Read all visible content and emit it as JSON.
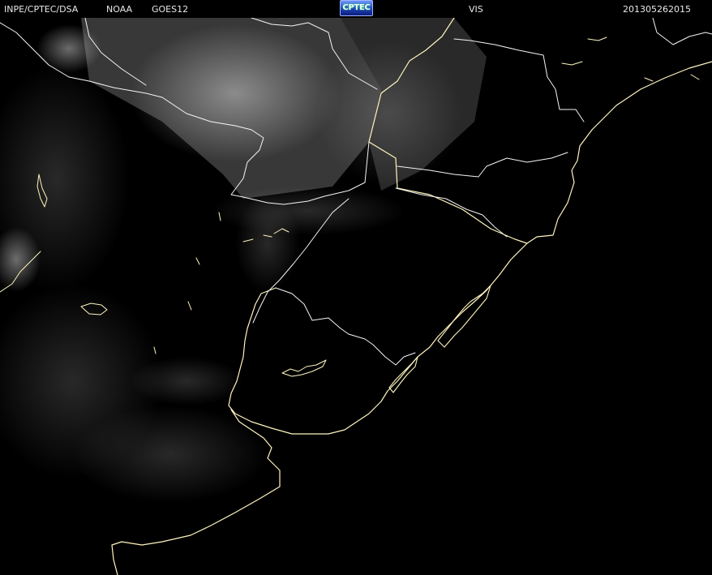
{
  "header": {
    "agency": "INPE/CPTEC/DSA",
    "source": "NOAA",
    "satellite": "GOES12",
    "logo_text": "CPTEC",
    "channel": "VIS",
    "timestamp": "201305262015"
  },
  "colors": {
    "background": "#000000",
    "header_text": "#e8e8e8",
    "coastline": "#fff5bf",
    "border": "#f5f5f5",
    "cloud": "#ffffff",
    "logo_blue": "#1c3db8"
  },
  "map": {
    "type": "satellite-visible-image",
    "features": [
      "cloud-cover",
      "coastlines",
      "political-borders",
      "lagoons"
    ]
  }
}
